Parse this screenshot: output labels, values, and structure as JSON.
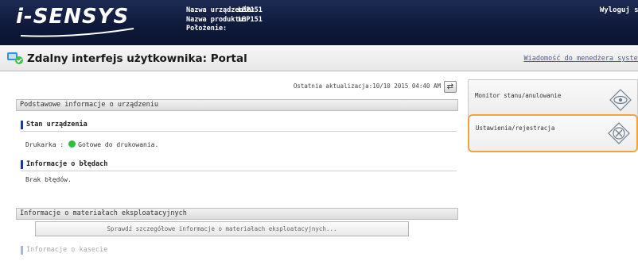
{
  "header": {
    "logo": "i-SENSYS",
    "device_name_label": "Nazwa urządzenia:",
    "device_name": "LBP151",
    "product_name_label": "Nazwa produktu:",
    "product_name": "LBP151",
    "location_label": "Położenie:",
    "location": "",
    "logout": "Wyloguj si"
  },
  "titlebar": {
    "title": "Zdalny interfejs użytkownika: Portal",
    "admin_message_link": "Wiadomość do menedżera systemu"
  },
  "main": {
    "last_updated": "Ostatnia aktualizacja:10/10 2015 04:40 AM",
    "basic_info": {
      "section_title": "Podstawowe informacje o urządzeniu",
      "device_status_heading": "Stan urządzenia",
      "printer_label": "Drukarka :",
      "printer_status": "Gotowe do drukowania.",
      "printer_status_color": "#2fbf3a",
      "error_heading": "Informacje o błędach",
      "error_text": "Brak błędów."
    },
    "consumables": {
      "section_title": "Informacje o materiałach eksploatacyjnych",
      "details_button": "Sprawdź szczegółowe informacje o materiałach eksploatacyjnych...",
      "cassette_heading": "Informacje o kasecie"
    }
  },
  "sidebar": {
    "status_monitor": "Monitor stanu/anulowanie",
    "settings": "Ustawienia/rejestracja",
    "highlight_color": "#f2a33a"
  }
}
